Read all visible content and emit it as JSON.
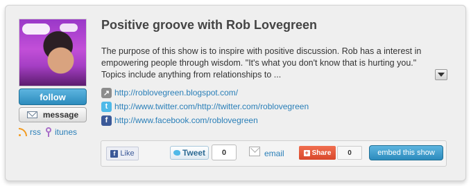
{
  "show": {
    "title": "Positive groove with Rob Lovegreen",
    "description": "The purpose of this show is to inspire with positive discussion. Rob has a interest in empowering people through wisdom. \"It's what you don't know that is hurting you.\" Topics include anything from relationships to ..."
  },
  "actions": {
    "follow_label": "follow",
    "message_label": "message",
    "rss_label": "rss",
    "itunes_label": "itunes"
  },
  "links": [
    {
      "icon": "share-icon",
      "url": "http://roblovegreen.blogspot.com/"
    },
    {
      "icon": "twitter-icon",
      "url": "http://www.twitter.com/http://twitter.com/roblovegreen"
    },
    {
      "icon": "facebook-icon",
      "url": "http://www.facebook.com/roblovegreen"
    }
  ],
  "share_bar": {
    "like_label": "Like",
    "tweet_label": "Tweet",
    "tweet_count": "0",
    "email_label": "email",
    "share_label": "Share",
    "share_count": "0",
    "embed_label": "embed this show"
  },
  "colors": {
    "accent": "#2c8bbd",
    "link": "#2a7fb8",
    "card_bg": "#efefef"
  }
}
